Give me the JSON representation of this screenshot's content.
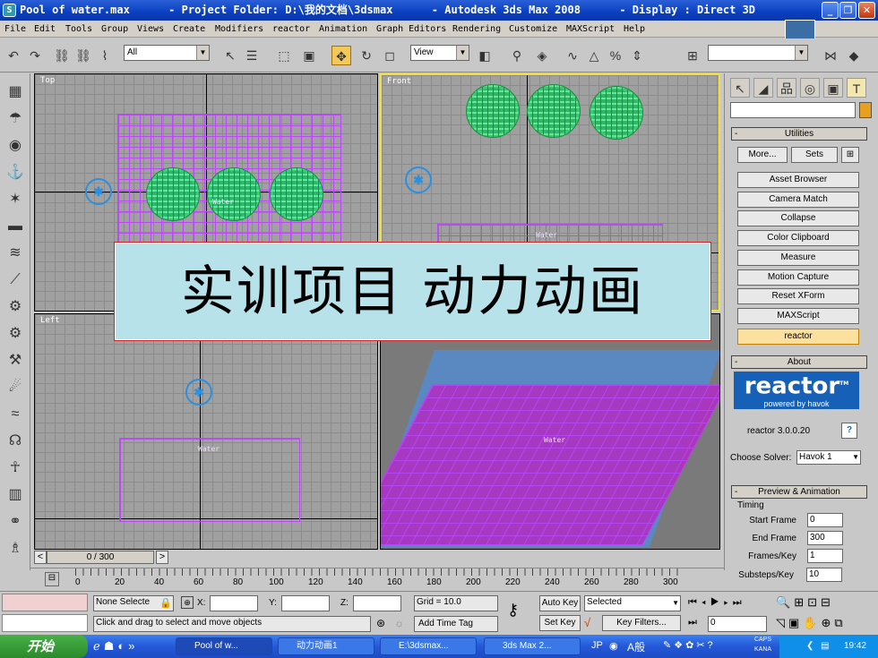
{
  "window": {
    "title": "Pool of water.max      - Project Folder: D:\\我的文档\\3dsmax      - Autodesk 3ds Max 2008      - Display : Direct 3D",
    "app_icon": "3ds-max-icon",
    "controls": {
      "minimize": "_",
      "maximize": "❐",
      "close": "✕"
    }
  },
  "menu": [
    "File",
    "Edit",
    "Tools",
    "Group",
    "Views",
    "Create",
    "Modifiers",
    "reactor",
    "Animation",
    "Graph Editors",
    "Rendering",
    "Customize",
    "MAXScript",
    "Help"
  ],
  "toolbar": {
    "selection_filter": "All",
    "reference_coord": "View",
    "named_selection": ""
  },
  "viewports": {
    "top": {
      "label": "Top",
      "object_label": "Water"
    },
    "front": {
      "label": "Front",
      "object_label": "Water"
    },
    "left": {
      "label": "Left",
      "object_label": "Water"
    },
    "perspective": {
      "label": "",
      "object_label": "Water"
    }
  },
  "banner": {
    "text": "实训项目 动力动画"
  },
  "command_panel": {
    "name_field": "",
    "utilities": {
      "title": "Utilities",
      "more": "More...",
      "sets": "Sets",
      "buttons": [
        "Asset Browser",
        "Camera Match",
        "Collapse",
        "Color Clipboard",
        "Measure",
        "Motion Capture",
        "Reset XForm",
        "MAXScript",
        "reactor"
      ],
      "selected": "reactor"
    },
    "about": {
      "title": "About",
      "logo_text": "reactor",
      "logo_tm": "TM",
      "logo_sub": "powered by havok",
      "version": "reactor 3.0.0.20",
      "help": "?",
      "solver_label": "Choose Solver:",
      "solver_value": "Havok 1"
    },
    "preview": {
      "title": "Preview & Animation",
      "timing": "Timing",
      "start_label": "Start Frame",
      "start_value": "0",
      "end_label": "End Frame",
      "end_value": "300",
      "fpk_label": "Frames/Key",
      "fpk_value": "1",
      "substeps_label": "Substeps/Key",
      "substeps_value": "10"
    }
  },
  "timeline": {
    "slider": "0 / 300",
    "ticks": [
      "0",
      "20",
      "40",
      "60",
      "80",
      "100",
      "120",
      "140",
      "160",
      "180",
      "200",
      "220",
      "240",
      "260",
      "280",
      "300"
    ]
  },
  "status": {
    "selection": "None Selecte",
    "x_label": "X:",
    "x_value": "",
    "y_label": "Y:",
    "y_value": "",
    "z_label": "Z:",
    "z_value": "",
    "grid": "Grid = 10.0",
    "prompt": "Click and drag to select and move objects",
    "add_time_tag": "Add Time Tag",
    "auto_key": "Auto Key",
    "set_key": "Set Key",
    "key_mode": "Selected",
    "key_filters": "Key Filters...",
    "frame": "0"
  },
  "taskbar": {
    "start": "开始",
    "tasks": [
      "Pool of w...",
      "动力动画1",
      "E:\\3dsmax...",
      "3ds Max 2..."
    ],
    "active_task": "Pool of w...",
    "lang": "JP",
    "ime": "A般",
    "caps": "CAPS",
    "kana": "KANA",
    "time": "19:42"
  }
}
